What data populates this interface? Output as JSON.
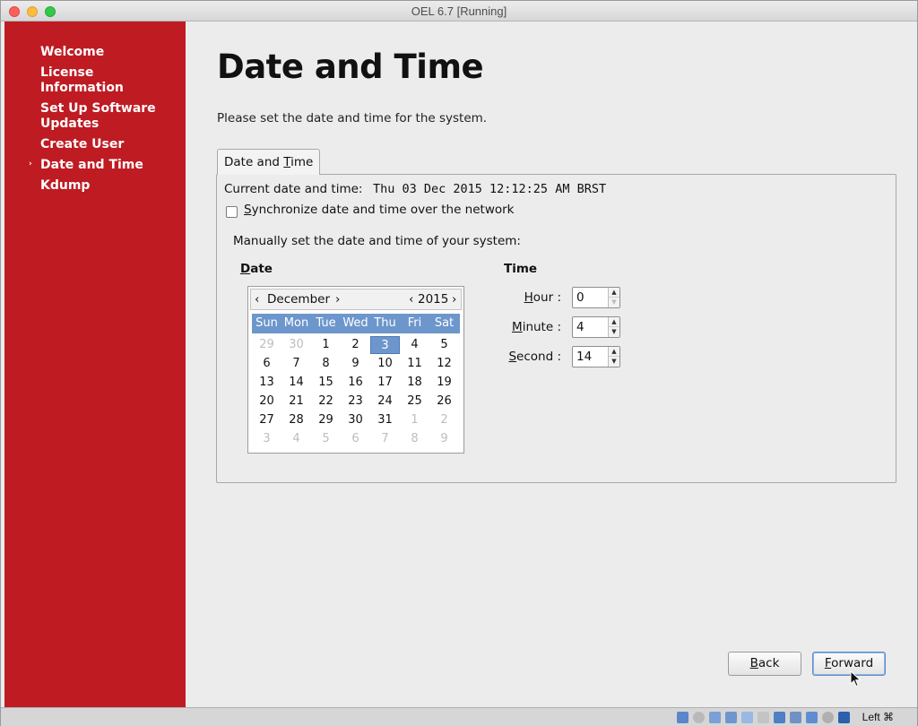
{
  "window": {
    "title": "OEL 6.7 [Running]"
  },
  "sidebar": {
    "items": [
      {
        "label": "Welcome"
      },
      {
        "label": "License Information"
      },
      {
        "label": "Set Up Software Updates"
      },
      {
        "label": "Create User"
      },
      {
        "label": "Date and Time",
        "active": true
      },
      {
        "label": "Kdump"
      }
    ],
    "active_marker": "›",
    "color": "#bf1b23"
  },
  "main": {
    "title": "Date and Time",
    "subtitle": "Please set the date and time for the system.",
    "tab_label_pre": "Date and ",
    "tab_label_mnemonic": "T",
    "tab_label_post": "ime",
    "current_label": "Current date and time:",
    "current_value": "Thu 03 Dec 2015 12:12:25 AM BRST",
    "sync_pre": "",
    "sync_mnemonic": "S",
    "sync_post": "ynchronize date and time over the network",
    "sync_checked": false,
    "manual_label": "Manually set the date and time of your system:",
    "date_heading_mnemonic": "D",
    "date_heading_post": "ate",
    "time_heading": "Time"
  },
  "calendar": {
    "month": "December",
    "year": "2015",
    "prev_month": "‹",
    "next_month": "›",
    "prev_year": "‹",
    "next_year": "›",
    "day_names": [
      "Sun",
      "Mon",
      "Tue",
      "Wed",
      "Thu",
      "Fri",
      "Sat"
    ],
    "weeks": [
      [
        "29",
        "30",
        "1",
        "2",
        "3",
        "4",
        "5"
      ],
      [
        "6",
        "7",
        "8",
        "9",
        "10",
        "11",
        "12"
      ],
      [
        "13",
        "14",
        "15",
        "16",
        "17",
        "18",
        "19"
      ],
      [
        "20",
        "21",
        "22",
        "23",
        "24",
        "25",
        "26"
      ],
      [
        "27",
        "28",
        "29",
        "30",
        "31",
        "1",
        "2"
      ],
      [
        "3",
        "4",
        "5",
        "6",
        "7",
        "8",
        "9"
      ]
    ],
    "dim": [
      [
        0,
        0
      ],
      [
        0,
        1
      ],
      [
        4,
        5
      ],
      [
        4,
        6
      ],
      [
        5,
        0
      ],
      [
        5,
        1
      ],
      [
        5,
        2
      ],
      [
        5,
        3
      ],
      [
        5,
        4
      ],
      [
        5,
        5
      ],
      [
        5,
        6
      ]
    ],
    "selected": [
      0,
      4
    ],
    "header_color": "#6d96cc"
  },
  "time": {
    "hour_label_mnemonic": "H",
    "hour_label_post": "our :",
    "hour_value": "0",
    "minute_label_mnemonic": "M",
    "minute_label_post": "inute :",
    "minute_value": "4",
    "second_label_mnemonic": "S",
    "second_label_post": "econd :",
    "second_value": "14"
  },
  "buttons": {
    "back_mnemonic": "B",
    "back_post": "ack",
    "forward_mnemonic": "F",
    "forward_post": "orward"
  },
  "statusbar": {
    "host_key": "Left ⌘"
  }
}
